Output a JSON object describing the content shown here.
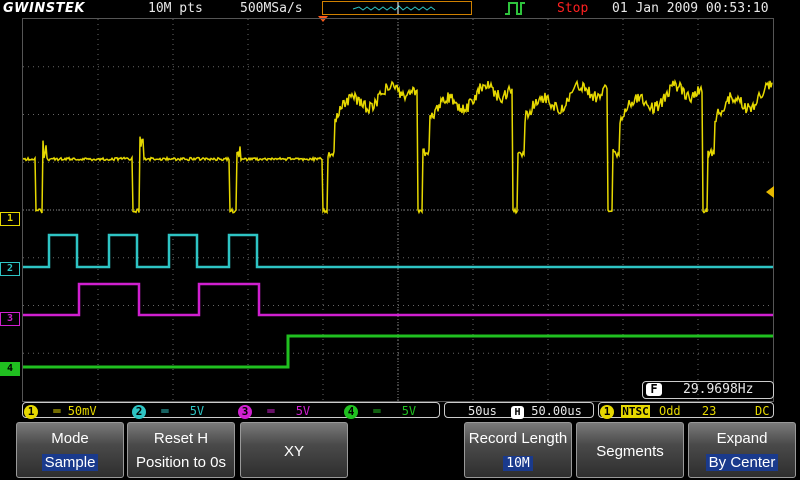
{
  "top": {
    "brand": "GWINSTEK",
    "record_points": "10M pts",
    "sample_rate": "500MSa/s",
    "run_state": "Stop",
    "datetime": "01 Jan 2009 00:53:10"
  },
  "channels": [
    {
      "id": "1",
      "color": "#e6d800"
    },
    {
      "id": "2",
      "color": "#2ec4c4"
    },
    {
      "id": "3",
      "color": "#d020d0"
    },
    {
      "id": "4",
      "color": "#20c020"
    }
  ],
  "measure": {
    "label": "F",
    "value": "29.9698Hz"
  },
  "status": {
    "ch1_scale": "50mV",
    "ch2_scale": "5V",
    "ch3_scale": "5V",
    "ch4_scale": "5V",
    "timebase": "50us",
    "h_position": "50.00us",
    "trigger_ch": "1",
    "trigger_source": "NTSC",
    "trigger_field": "Odd",
    "trigger_line": "23",
    "trigger_coupling": "DC"
  },
  "softkeys": [
    {
      "title": "Mode",
      "value": "Sample"
    },
    {
      "title": "Reset H",
      "value": "Position to 0s"
    },
    {
      "title": "XY",
      "value": ""
    },
    {
      "title": "Record Length",
      "value": "10M"
    },
    {
      "title": "Segments",
      "value": ""
    },
    {
      "title": "Expand",
      "value": "By Center"
    }
  ]
}
